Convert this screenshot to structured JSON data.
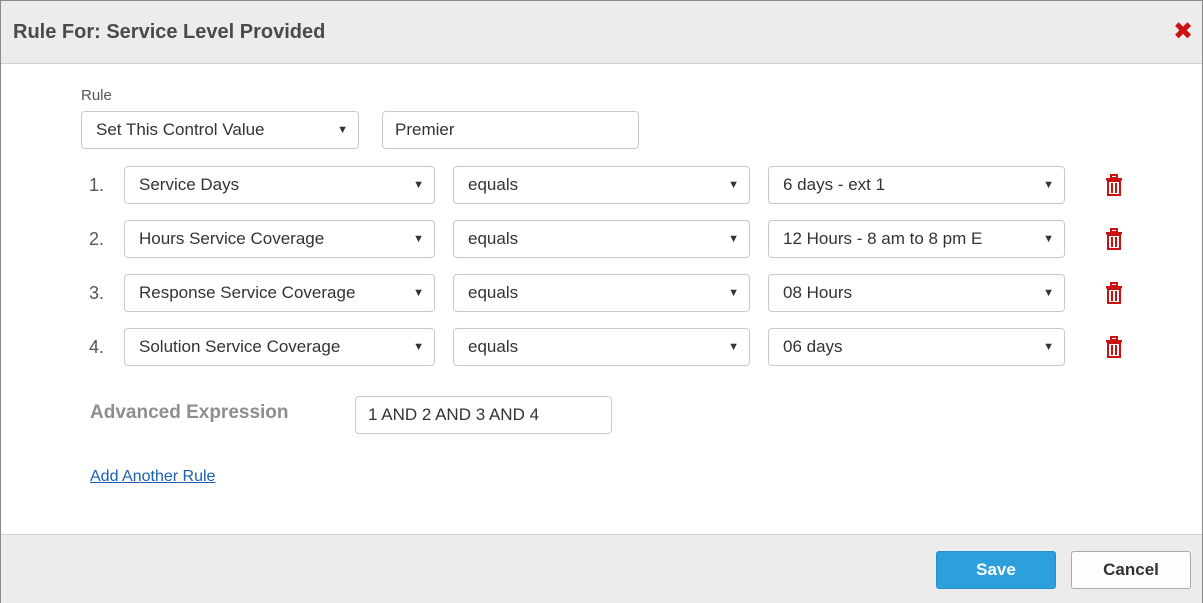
{
  "dialog": {
    "title": "Rule For: Service Level Provided",
    "close_icon": "close-icon"
  },
  "rule": {
    "label": "Rule",
    "action": "Set This Control Value",
    "value": "Premier"
  },
  "conditions": [
    {
      "number": "1.",
      "field": "Service Days",
      "operator": "equals",
      "value": "6 days - ext 1"
    },
    {
      "number": "2.",
      "field": "Hours Service Coverage",
      "operator": "equals",
      "value": "12 Hours - 8 am to 8 pm E"
    },
    {
      "number": "3.",
      "field": "Response Service Coverage",
      "operator": "equals",
      "value": "08 Hours"
    },
    {
      "number": "4.",
      "field": "Solution Service Coverage",
      "operator": "equals",
      "value": "06 days"
    }
  ],
  "advanced": {
    "label": "Advanced Expression",
    "value": "1 AND 2 AND 3 AND 4"
  },
  "add_rule_link": "Add Another Rule",
  "footer": {
    "save_label": "Save",
    "cancel_label": "Cancel"
  },
  "colors": {
    "close": "#cc1111",
    "trash": "#cc1111",
    "save_bg": "#2c9fdc",
    "link": "#1a5fb4"
  }
}
